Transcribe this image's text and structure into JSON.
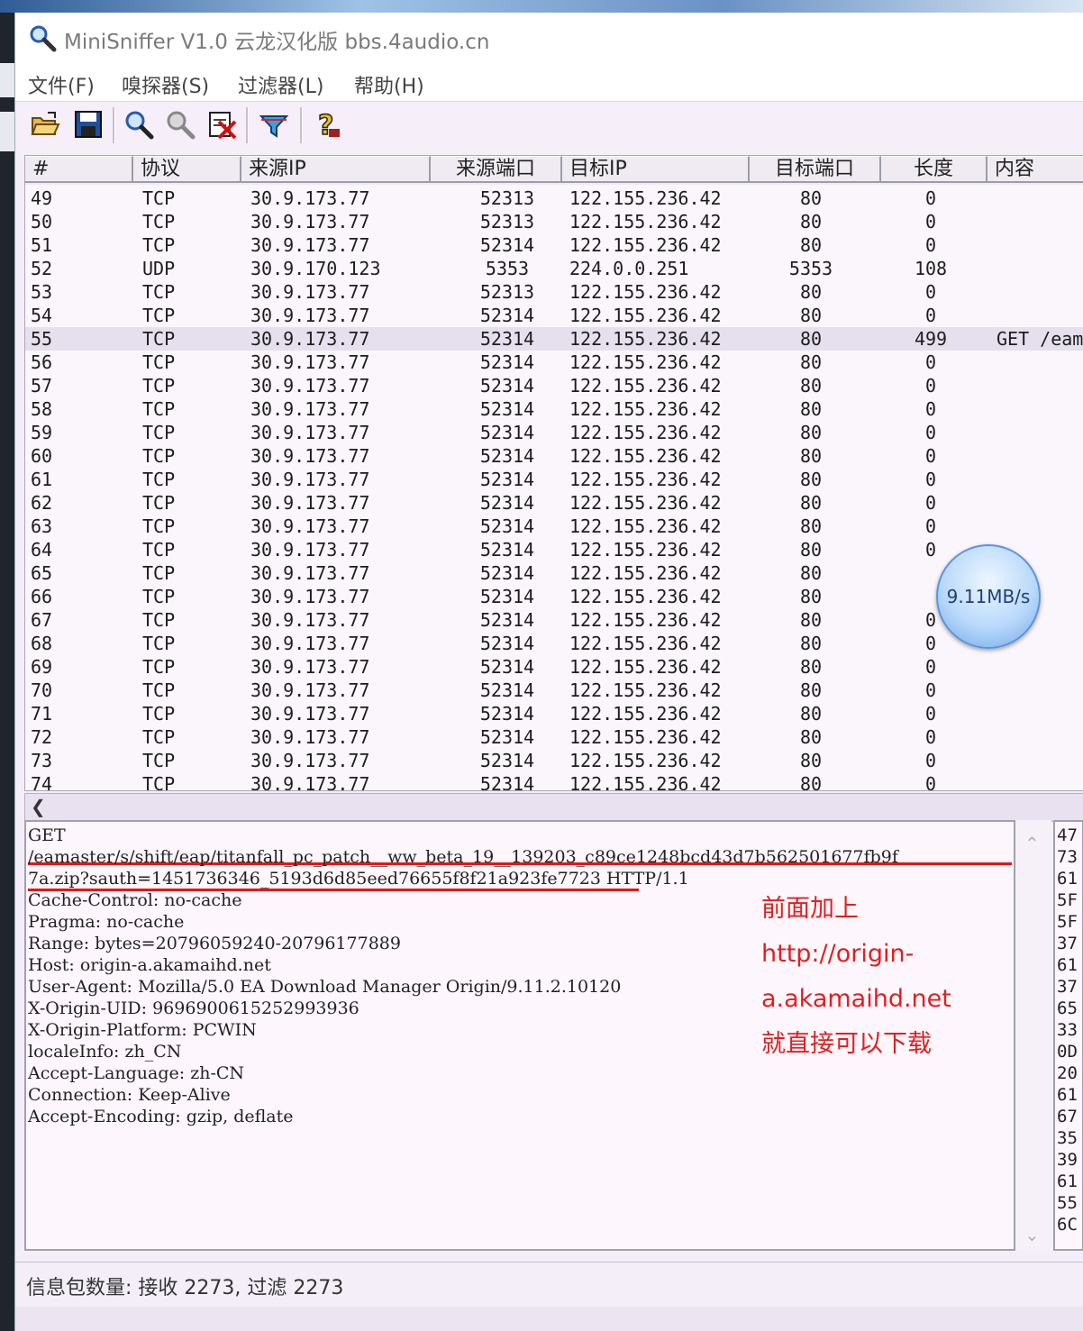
{
  "window": {
    "title": "MiniSniffer V1.0 云龙汉化版 bbs.4audio.cn"
  },
  "menu": [
    "文件(F)",
    "嗅探器(S)",
    "过滤器(L)",
    "帮助(H)"
  ],
  "toolbar": {
    "icons": [
      "open-folder-icon",
      "save-icon",
      "start-sniff-icon",
      "stop-sniff-icon",
      "clear-icon",
      "filter-icon",
      "help-icon"
    ]
  },
  "table": {
    "columns": [
      "#",
      "协议",
      "来源IP",
      "来源端口",
      "目标IP",
      "目标端口",
      "长度",
      "内容"
    ],
    "rows": [
      [
        "49",
        "TCP",
        "30.9.173.77",
        "52313",
        "122.155.236.42",
        "80",
        "0",
        ""
      ],
      [
        "50",
        "TCP",
        "30.9.173.77",
        "52313",
        "122.155.236.42",
        "80",
        "0",
        ""
      ],
      [
        "51",
        "TCP",
        "30.9.173.77",
        "52314",
        "122.155.236.42",
        "80",
        "0",
        ""
      ],
      [
        "52",
        "UDP",
        "30.9.170.123",
        "5353",
        "224.0.0.251",
        "5353",
        "108",
        ""
      ],
      [
        "53",
        "TCP",
        "30.9.173.77",
        "52313",
        "122.155.236.42",
        "80",
        "0",
        ""
      ],
      [
        "54",
        "TCP",
        "30.9.173.77",
        "52314",
        "122.155.236.42",
        "80",
        "0",
        ""
      ],
      [
        "55",
        "TCP",
        "30.9.173.77",
        "52314",
        "122.155.236.42",
        "80",
        "499",
        "GET /eam"
      ],
      [
        "56",
        "TCP",
        "30.9.173.77",
        "52314",
        "122.155.236.42",
        "80",
        "0",
        ""
      ],
      [
        "57",
        "TCP",
        "30.9.173.77",
        "52314",
        "122.155.236.42",
        "80",
        "0",
        ""
      ],
      [
        "58",
        "TCP",
        "30.9.173.77",
        "52314",
        "122.155.236.42",
        "80",
        "0",
        ""
      ],
      [
        "59",
        "TCP",
        "30.9.173.77",
        "52314",
        "122.155.236.42",
        "80",
        "0",
        ""
      ],
      [
        "60",
        "TCP",
        "30.9.173.77",
        "52314",
        "122.155.236.42",
        "80",
        "0",
        ""
      ],
      [
        "61",
        "TCP",
        "30.9.173.77",
        "52314",
        "122.155.236.42",
        "80",
        "0",
        ""
      ],
      [
        "62",
        "TCP",
        "30.9.173.77",
        "52314",
        "122.155.236.42",
        "80",
        "0",
        ""
      ],
      [
        "63",
        "TCP",
        "30.9.173.77",
        "52314",
        "122.155.236.42",
        "80",
        "0",
        ""
      ],
      [
        "64",
        "TCP",
        "30.9.173.77",
        "52314",
        "122.155.236.42",
        "80",
        "0",
        ""
      ],
      [
        "65",
        "TCP",
        "30.9.173.77",
        "52314",
        "122.155.236.42",
        "80",
        "",
        ""
      ],
      [
        "66",
        "TCP",
        "30.9.173.77",
        "52314",
        "122.155.236.42",
        "80",
        "",
        ""
      ],
      [
        "67",
        "TCP",
        "30.9.173.77",
        "52314",
        "122.155.236.42",
        "80",
        "0",
        ""
      ],
      [
        "68",
        "TCP",
        "30.9.173.77",
        "52314",
        "122.155.236.42",
        "80",
        "0",
        ""
      ],
      [
        "69",
        "TCP",
        "30.9.173.77",
        "52314",
        "122.155.236.42",
        "80",
        "0",
        ""
      ],
      [
        "70",
        "TCP",
        "30.9.173.77",
        "52314",
        "122.155.236.42",
        "80",
        "0",
        ""
      ],
      [
        "71",
        "TCP",
        "30.9.173.77",
        "52314",
        "122.155.236.42",
        "80",
        "0",
        ""
      ],
      [
        "72",
        "TCP",
        "30.9.173.77",
        "52314",
        "122.155.236.42",
        "80",
        "0",
        ""
      ],
      [
        "73",
        "TCP",
        "30.9.173.77",
        "52314",
        "122.155.236.42",
        "80",
        "0",
        ""
      ],
      [
        "74",
        "TCP",
        "30.9.173.77",
        "52314",
        "122.155.236.42",
        "80",
        "0",
        ""
      ]
    ],
    "selected_row": "55"
  },
  "detail": {
    "lines": [
      "GET",
      "/eamaster/s/shift/eap/titanfall_pc_patch__ww_beta_19__139203_c89ce1248bcd43d7b562501677fb9f",
      "7a.zip?sauth=1451736346_5193d6d85eed76655f8f21a923fe7723 HTTP/1.1",
      "Cache-Control: no-cache",
      "Pragma: no-cache",
      "Range: bytes=20796059240-20796177889",
      "Host: origin-a.akamaihd.net",
      "User-Agent: Mozilla/5.0 EA Download Manager Origin/9.11.2.10120",
      "X-Origin-UID: 9696900615252993936",
      "X-Origin-Platform: PCWIN",
      "localeInfo: zh_CN",
      "Accept-Language: zh-CN",
      "Connection: Keep-Alive",
      "Accept-Encoding: gzip, deflate"
    ],
    "hex": [
      "47",
      "73",
      "61",
      "5F",
      "5F",
      "37",
      "61",
      "37",
      "65",
      "33",
      "0D",
      "20",
      "61",
      "67",
      "35",
      "39",
      "61",
      "55",
      "6C"
    ]
  },
  "annotation": {
    "lines": [
      "前面加上",
      "http://origin-",
      "a.akamaihd.net",
      "就直接可以下载"
    ],
    "color": "#e02020"
  },
  "status": {
    "text": "信息包数量: 接收 2273, 过滤 2273"
  },
  "speed_widget": {
    "text": "9.11MB/s"
  }
}
